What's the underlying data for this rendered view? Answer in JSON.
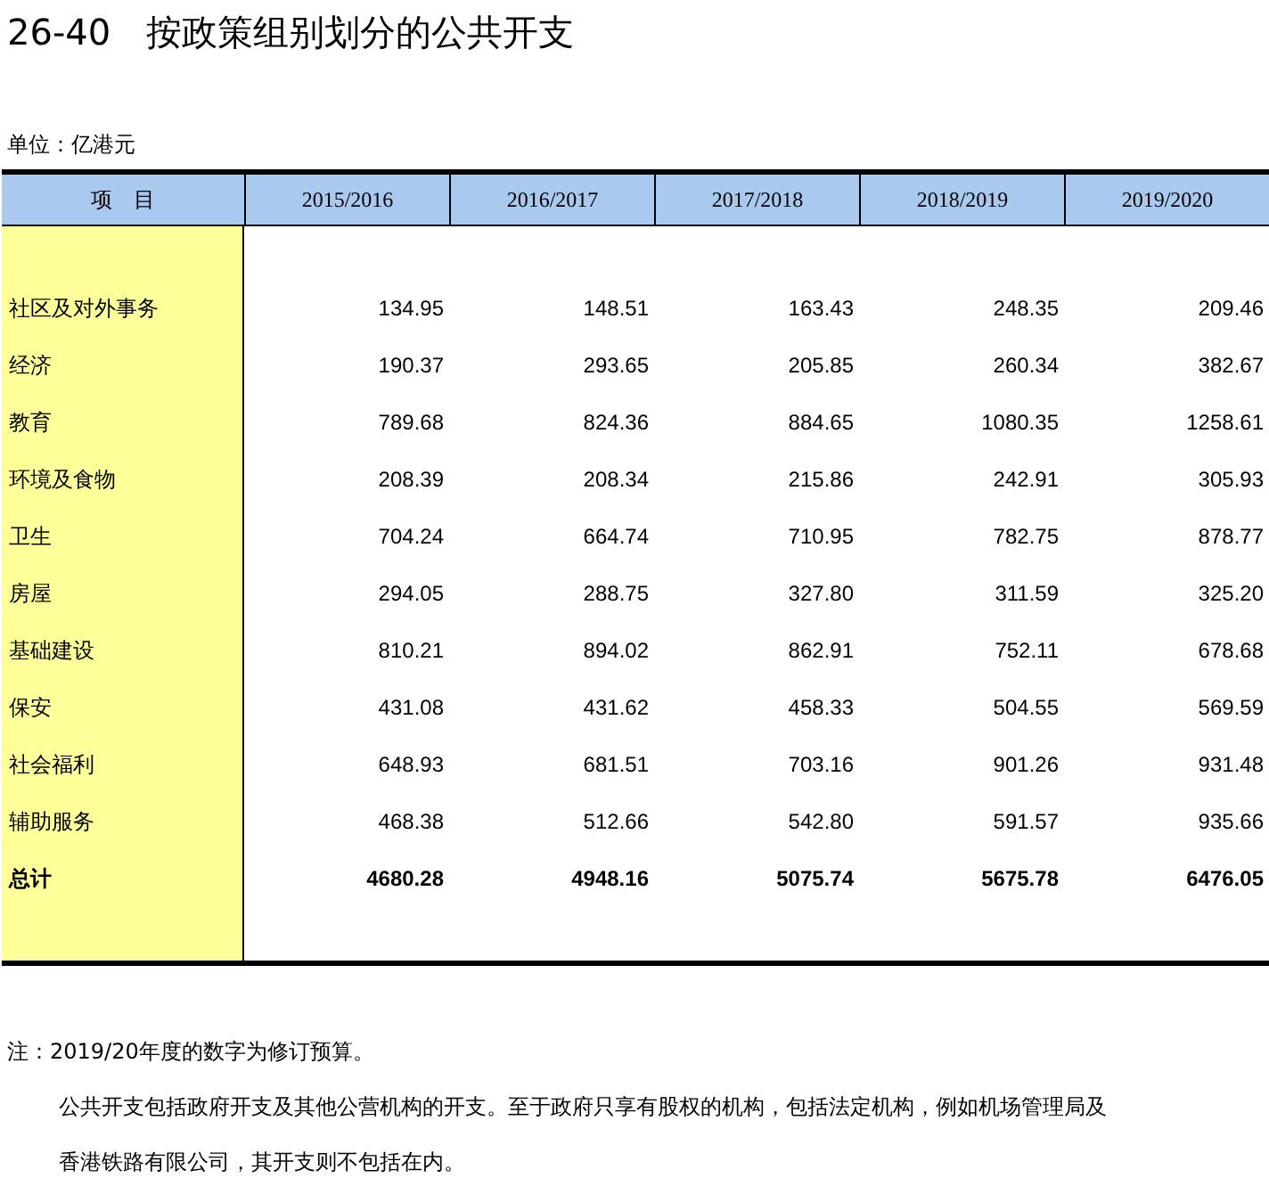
{
  "title": "26-40　按政策组别划分的公共开支",
  "unit": "单位：亿港元",
  "table": {
    "columns": [
      "项　目",
      "2015/2016",
      "2016/2017",
      "2017/2018",
      "2018/2019",
      "2019/2020"
    ],
    "rows": [
      {
        "kind": "item",
        "label": "社区及对外事务",
        "values": [
          "134.95",
          "148.51",
          "163.43",
          "248.35",
          "209.46"
        ]
      },
      {
        "kind": "item",
        "label": "经济",
        "values": [
          "190.37",
          "293.65",
          "205.85",
          "260.34",
          "382.67"
        ]
      },
      {
        "kind": "item",
        "label": "教育",
        "values": [
          "789.68",
          "824.36",
          "884.65",
          "1080.35",
          "1258.61"
        ]
      },
      {
        "kind": "item",
        "label": "环境及食物",
        "values": [
          "208.39",
          "208.34",
          "215.86",
          "242.91",
          "305.93"
        ]
      },
      {
        "kind": "item",
        "label": "卫生",
        "values": [
          "704.24",
          "664.74",
          "710.95",
          "782.75",
          "878.77"
        ]
      },
      {
        "kind": "item",
        "label": "房屋",
        "values": [
          "294.05",
          "288.75",
          "327.80",
          "311.59",
          "325.20"
        ]
      },
      {
        "kind": "item",
        "label": "基础建设",
        "values": [
          "810.21",
          "894.02",
          "862.91",
          "752.11",
          "678.68"
        ]
      },
      {
        "kind": "item",
        "label": "保安",
        "values": [
          "431.08",
          "431.62",
          "458.33",
          "504.55",
          "569.59"
        ]
      },
      {
        "kind": "item",
        "label": "社会福利",
        "values": [
          "648.93",
          "681.51",
          "703.16",
          "901.26",
          "931.48"
        ]
      },
      {
        "kind": "item",
        "label": "辅助服务",
        "values": [
          "468.38",
          "512.66",
          "542.80",
          "591.57",
          "935.66"
        ]
      },
      {
        "kind": "total",
        "label": "总计",
        "values": [
          "4680.28",
          "4948.16",
          "5075.74",
          "5675.78",
          "6476.05"
        ]
      }
    ]
  },
  "notes": [
    "注：2019/20年度的数字为修订预算。",
    "公共开支包括政府开支及其他公营机构的开支。至于政府只享有股权的机构，包括法定机构，例如机场管理局及",
    "香港铁路有限公司，其开支则不包括在内。"
  ]
}
